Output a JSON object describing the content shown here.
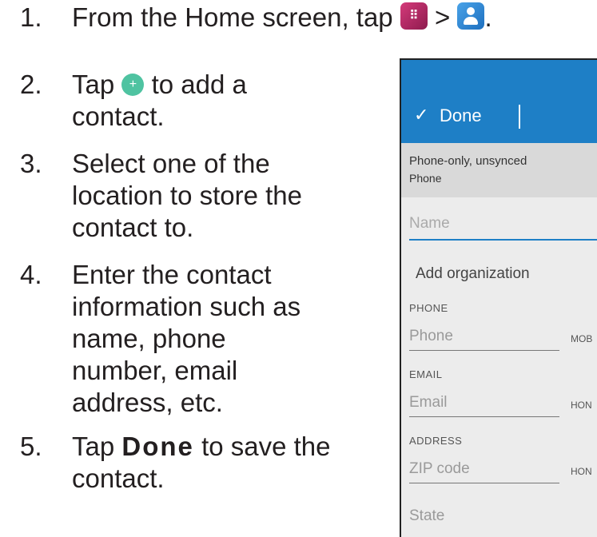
{
  "steps": [
    {
      "num": "1.",
      "lines": [
        "From the Home screen, tap",
        ">",
        "."
      ]
    },
    {
      "num": "2.",
      "lines": [
        "Tap",
        "to add a",
        "contact."
      ]
    },
    {
      "num": "3.",
      "lines": [
        "Select one of the",
        "location to store the",
        "contact to."
      ]
    },
    {
      "num": "4.",
      "lines": [
        "Enter the contact",
        "information such as",
        "name, phone",
        "number, email",
        "address, etc."
      ]
    },
    {
      "num": "5.",
      "lines": [
        "Tap",
        "Done",
        "to save the",
        "contact."
      ]
    }
  ],
  "icons": {
    "apps": "apps-icon",
    "contacts": "contacts-icon",
    "add": "add-contact-icon"
  },
  "phone": {
    "done_label": "Done",
    "account_title": "Phone-only, unsynced",
    "account_sub": "Phone",
    "name_placeholder": "Name",
    "add_org": "Add organization",
    "phone_section": "PHONE",
    "phone_placeholder": "Phone",
    "phone_type": "MOB",
    "email_section": "EMAIL",
    "email_placeholder": "Email",
    "email_type": "HON",
    "address_section": "ADDRESS",
    "zip_placeholder": "ZIP code",
    "zip_type": "HON",
    "state_placeholder": "State"
  },
  "colors": {
    "accent": "#1e7fc6",
    "add_button": "#4fc3a1",
    "apps_icon": "#c2306c"
  }
}
